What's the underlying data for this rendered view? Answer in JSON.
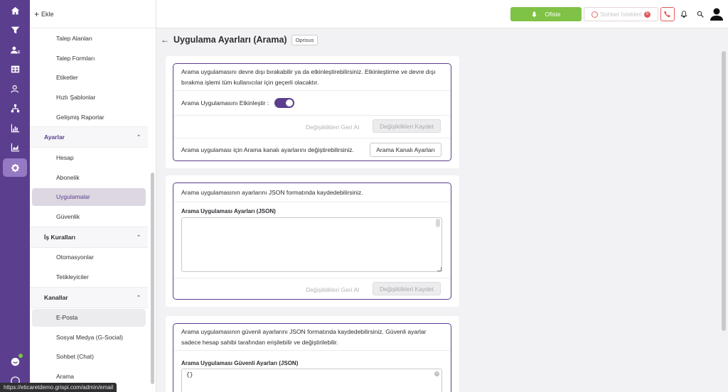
{
  "header": {
    "add_label": "Ekle",
    "status_label": "Ofiste",
    "chat_requests_label": "Sohbet İstekleri",
    "chat_requests_count": "0"
  },
  "sidebar": {
    "items_top": [
      {
        "label": "Talep Alanları"
      },
      {
        "label": "Talep Formları"
      },
      {
        "label": "Etiketler"
      },
      {
        "label": "Hızlı Şablonlar"
      },
      {
        "label": "Gelişmiş Raporlar"
      }
    ],
    "section_ayarlar": "Ayarlar",
    "items_ayarlar": [
      {
        "label": "Hesap"
      },
      {
        "label": "Abonelik"
      },
      {
        "label": "Uygulamalar"
      },
      {
        "label": "Güvenlik"
      }
    ],
    "section_is_kurallari": "İş Kuralları",
    "items_is_kurallari": [
      {
        "label": "Otomasyonlar"
      },
      {
        "label": "Tetikleyiciler"
      }
    ],
    "section_kanallar": "Kanallar",
    "items_kanallar": [
      {
        "label": "E-Posta"
      },
      {
        "label": "Sosyal Medya (G-Social)"
      },
      {
        "label": "Sohbet (Chat)"
      },
      {
        "label": "Arama"
      }
    ]
  },
  "status_url": "https://eticaretdemo.grispi.com/admin/email",
  "page": {
    "title": "Uygulama Ayarları (Arama)",
    "tag": "Oprisus"
  },
  "card1": {
    "description": "Arama uygulamasını devre dışı bırakabilir ya da etkinleştirebilirsiniz. Etkinleştirme ve devre dışı bırakma işlemi tüm kullanıcılar için geçerli olacaktır.",
    "toggle_label": "Arama Uygulamasını Etkinleştir :",
    "toggle_on": true,
    "revert_label": "Değişiklikleri Geri Al",
    "save_label": "Değişiklikleri Kaydet",
    "channel_text": "Arama uygulaması için Arama kanalı ayarlarını değiştirebilirsiniz.",
    "channel_button": "Arama Kanalı Ayarları"
  },
  "card2": {
    "description": "Arama uygulamasının ayarlarını JSON formatında kaydedebilirsiniz.",
    "field_label": "Arama Uygulaması Ayarları (JSON)",
    "field_value": "",
    "revert_label": "Değişiklikleri Geri Al",
    "save_label": "Değişiklikleri Kaydet"
  },
  "card3": {
    "description": "Arama uygulamasının güvenli ayarlarını JSON formatında kaydedebilirsiniz. Güvenli ayarlar sadece hesap sahibi tarafından erişilebilir ve değiştirilebilir.",
    "field_label": "Arama Uygulaması Güvenli Ayarları (JSON)",
    "field_value": "{}"
  },
  "colors": {
    "brand": "#5b3f8e",
    "status_green": "#7fc245",
    "alert_red": "#e15757"
  }
}
